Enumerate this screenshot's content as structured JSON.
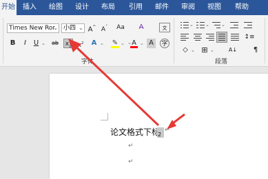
{
  "tabs": [
    "开始",
    "插入",
    "绘图",
    "设计",
    "布局",
    "引用",
    "邮件",
    "审阅",
    "视图",
    "帮助"
  ],
  "font_group": {
    "font_name": "Times New Ror",
    "font_size": "小四",
    "label": "字体",
    "grow_label": "A",
    "shrink_label": "A",
    "case_label": "Aa",
    "bold": "B",
    "italic": "I",
    "underline": "U",
    "strikethrough": "ab",
    "subscript": "x",
    "superscript": "x",
    "effects": "A",
    "font_color": "A",
    "char_shade": "A"
  },
  "paragraph_group": {
    "label": "段落"
  },
  "document": {
    "text": "论文格式下标",
    "subscript_text": "2",
    "paragraph_mark": "↵",
    "empty_mark_1": "↵",
    "empty_mark_2": "↵"
  },
  "colors": {
    "tab_bar": "#2b579a",
    "highlight_yellow": "#ffff00",
    "font_red": "#ff0000",
    "arrow_red": "#e53935"
  }
}
